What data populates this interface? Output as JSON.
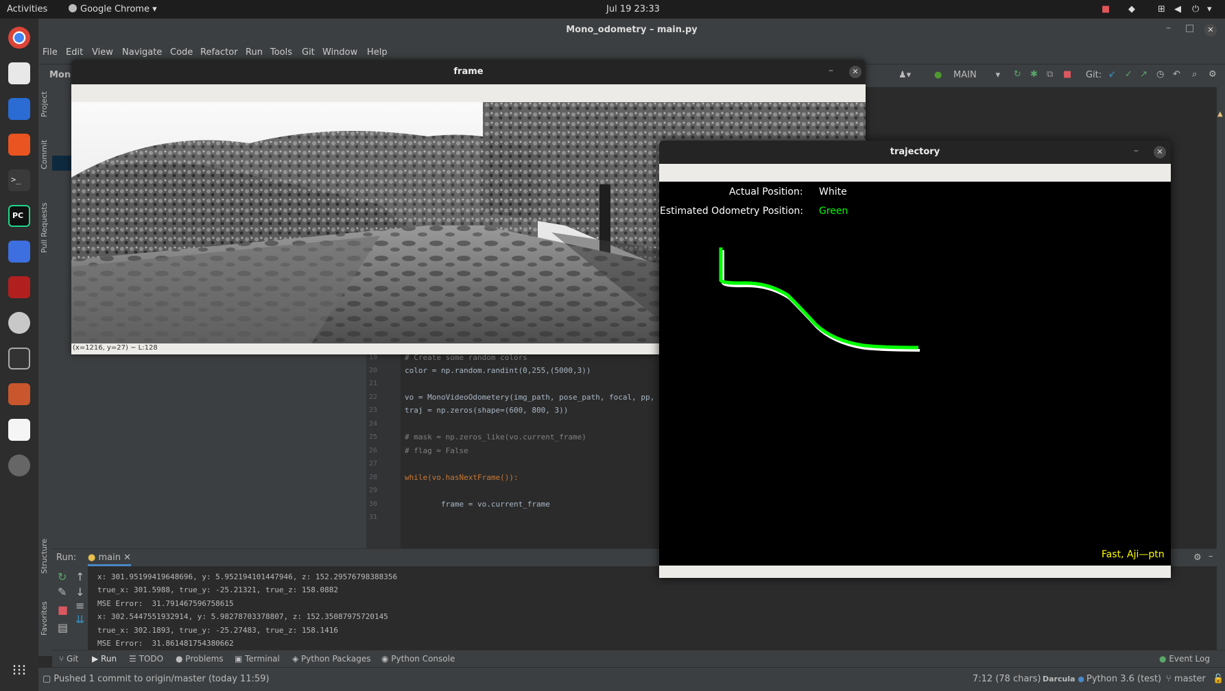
{
  "topbar": {
    "activities": "Activities",
    "app": "Google Chrome",
    "clock": "Jul 19  23:33"
  },
  "ide": {
    "title": "Mono_odometry – main.py",
    "menu": [
      "File",
      "Edit",
      "View",
      "Navigate",
      "Code",
      "Refactor",
      "Run",
      "Tools",
      "Git",
      "Window",
      "Help"
    ],
    "project_crumb": "Mono",
    "run_config": "MAIN",
    "git_label": "Git:",
    "left_tools": [
      "Project",
      "Commit",
      "Pull Requests",
      "Structure",
      "Favorites"
    ],
    "code_lines": [
      {
        "n": "19",
        "text": "# Create some random colors"
      },
      {
        "n": "20",
        "text": "color = np.random.randint(0,255,(5000,3))"
      },
      {
        "n": "21",
        "text": ""
      },
      {
        "n": "22",
        "text": "vo = MonoVideoOdometery(img_path, pose_path, focal, pp, l"
      },
      {
        "n": "23",
        "text": "traj = np.zeros(shape=(600, 800, 3))"
      },
      {
        "n": "24",
        "text": ""
      },
      {
        "n": "25",
        "text": "# mask = np.zeros_like(vo.current_frame)"
      },
      {
        "n": "26",
        "text": "# flag = False"
      },
      {
        "n": "27",
        "text": ""
      },
      {
        "n": "28",
        "text": "while(vo.hasNextFrame()):"
      },
      {
        "n": "29",
        "text": ""
      },
      {
        "n": "30",
        "text": "        frame = vo.current_frame"
      },
      {
        "n": "31",
        "text": ""
      }
    ],
    "run": {
      "label": "Run:",
      "tab": "main",
      "output": [
        "x: 301.95199419648696, y: 5.952194101447946, z: 152.29576798388356",
        "true_x: 301.5988, true_y: -25.21321, true_z: 158.0882",
        "MSE Error:  31.791467596758615",
        "x: 302.5447551932914, y: 5.98278703378807, z: 152.35087975720145",
        "true_x: 302.1893, true_y: -25.27483, true_z: 158.1416",
        "MSE Error:  31.861481754380662"
      ]
    },
    "bottom_tabs": [
      "Git",
      "Run",
      "TODO",
      "Problems",
      "Terminal",
      "Python Packages",
      "Python Console"
    ],
    "event_log": "Event Log",
    "status": {
      "message": "Pushed 1 commit to origin/master (today 11:59)",
      "position": "7:12 (78 chars)",
      "theme": "Darcula",
      "interpreter": "Python 3.6 (test)",
      "branch": "master"
    }
  },
  "frame_window": {
    "title": "frame",
    "status": "(x=1216, y=27) ~ L:128"
  },
  "trajectory_window": {
    "title": "trajectory",
    "actual_label": "Actual Position:",
    "actual_value": "White",
    "estimated_label": "Estimated Odometry Position:",
    "estimated_value": "Green",
    "footer": "Fast, Aji—ptn",
    "colors": {
      "actual": "#ffffff",
      "estimated": "#00ff00",
      "footer": "#ffff00"
    }
  },
  "icons": [
    "close-icon",
    "minimize-icon",
    "maximize-icon",
    "chrome-icon",
    "files-icon",
    "writer-icon",
    "software-icon",
    "terminal-icon",
    "pycharm-icon",
    "screenshot-icon",
    "app-grid-icon"
  ]
}
